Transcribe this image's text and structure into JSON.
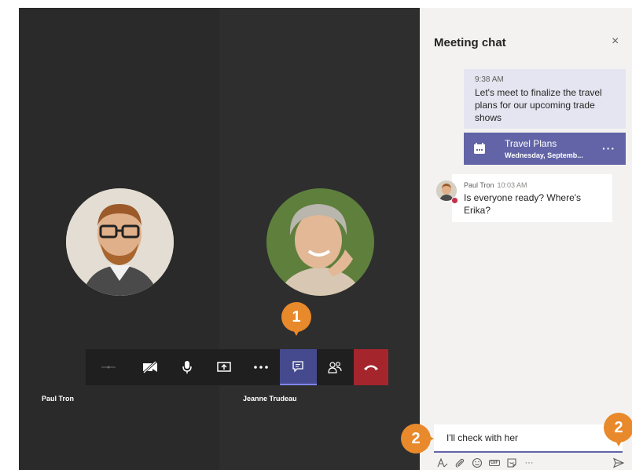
{
  "participants": [
    {
      "name": "Paul Tron"
    },
    {
      "name": "Jeanne Trudeau"
    }
  ],
  "callouts": [
    "1",
    "2",
    "2"
  ],
  "chat": {
    "title": "Meeting chat",
    "close_glyph": "×",
    "own_message": {
      "time": "9:38 AM",
      "text": "Let's meet to finalize the travel plans for our upcoming trade shows"
    },
    "card": {
      "title": "Travel Plans",
      "subtitle": "Wednesday, Septemb...",
      "more": "···"
    },
    "other_message": {
      "sender": "Paul Tron",
      "time": "10:03 AM",
      "text": "Is everyone ready? Where's Erika?"
    },
    "compose": {
      "value": "I'll check with her"
    },
    "tools": {
      "gif": "GIF",
      "more": "···"
    }
  },
  "colors": {
    "accent": "#6264a7",
    "hangup": "#a4262c",
    "callout": "#e8892b"
  },
  "icons": [
    "dialpad-icon",
    "camera-off-icon",
    "microphone-icon",
    "share-screen-icon",
    "more-icon",
    "chat-icon",
    "participants-icon",
    "hang-up-icon",
    "calendar-icon",
    "send-icon"
  ]
}
